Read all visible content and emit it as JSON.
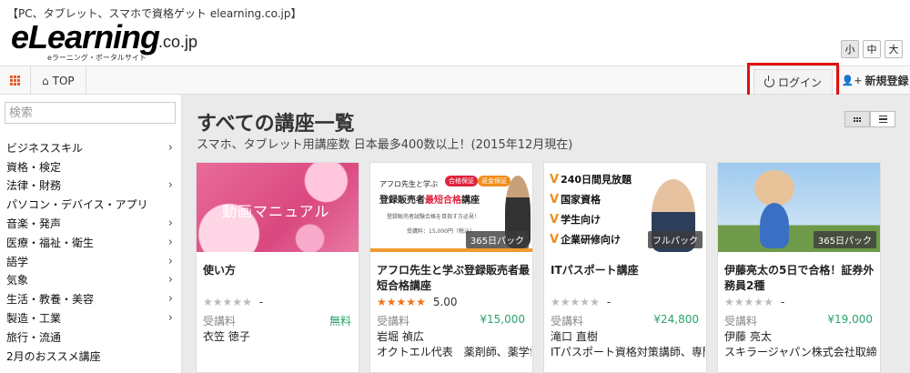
{
  "header": {
    "tagline": "【PC、タブレット、スマホで資格ゲット elearning.co.jp】",
    "logo_main": "eLearning",
    "logo_domain": ".co.jp",
    "logo_sub": "eラーニング・ポータルサイト",
    "font_sizes": [
      "小",
      "中",
      "大"
    ]
  },
  "nav": {
    "top_label": "TOP",
    "login_label": "ログイン",
    "register_label": "新規登録"
  },
  "sidebar": {
    "search_placeholder": "検索",
    "categories": [
      {
        "label": "ビジネススキル",
        "arrow": true
      },
      {
        "label": "資格・検定",
        "arrow": false
      },
      {
        "label": "法律・財務",
        "arrow": true
      },
      {
        "label": "パソコン・デバイス・アプリ",
        "arrow": false
      },
      {
        "label": "音楽・発声",
        "arrow": true
      },
      {
        "label": "医療・福祉・衛生",
        "arrow": true
      },
      {
        "label": "語学",
        "arrow": true
      },
      {
        "label": "気象",
        "arrow": true
      },
      {
        "label": "生活・教養・美容",
        "arrow": true
      },
      {
        "label": "製造・工業",
        "arrow": true
      },
      {
        "label": "旅行・流通",
        "arrow": false
      },
      {
        "label": "2月のおススメ講座",
        "arrow": false
      }
    ]
  },
  "main": {
    "title": "すべての講座一覧",
    "subtitle": "スマホ、タブレット用講座数 日本最多400数以上！(2015年12月現在)"
  },
  "courses": [
    {
      "image_text": "動画マニュアル",
      "badge": "",
      "title": "使い方",
      "rating": 0,
      "rating_text": "-",
      "fee_label": "受講料",
      "fee": "無料",
      "instructor": "衣笠 徳子",
      "instructor_title": ""
    },
    {
      "image_text": "",
      "badge": "365日パック",
      "title": "アフロ先生と学ぶ登録販売者最短合格講座",
      "rating": 5,
      "rating_text": "5.00",
      "fee_label": "受講料",
      "fee": "¥15,000",
      "instructor": "岩堀 禎広",
      "instructor_title": "オクトエル代表　薬剤師、薬学博"
    },
    {
      "image_text": "",
      "badge": "フルパック",
      "title": "ITパスポート講座",
      "rating": 0,
      "rating_text": "-",
      "fee_label": "受講料",
      "fee": "¥24,800",
      "instructor": "滝口 直樹",
      "instructor_title": "ITパスポート資格対策講師、専門"
    },
    {
      "image_text": "",
      "badge": "365日パック",
      "title": "伊藤亮太の5日で合格！証券外務員2種",
      "rating": 0,
      "rating_text": "-",
      "fee_label": "受講料",
      "fee": "¥19,000",
      "instructor": "伊藤 亮太",
      "instructor_title": "スキラージャパン株式会社取締"
    }
  ],
  "afro_image": {
    "line1": "アフロ先生と学ぶ",
    "pill1": "合格保証",
    "pill2": "返金保証",
    "line2a": "登録販売者",
    "line2b": "最短合格",
    "line2c": "講座",
    "line3": "登録販売者試験合格を目指す方必見！",
    "line4": "受講料：15,000円（税込）"
  },
  "it_image": {
    "rows": [
      "240日間見放題",
      "国家資格",
      "学生向け",
      "企業研修向け"
    ]
  },
  "colors": {
    "accent_orange": "#f0741e",
    "fee_green": "#2aa36b",
    "login_highlight": "#e01010"
  }
}
